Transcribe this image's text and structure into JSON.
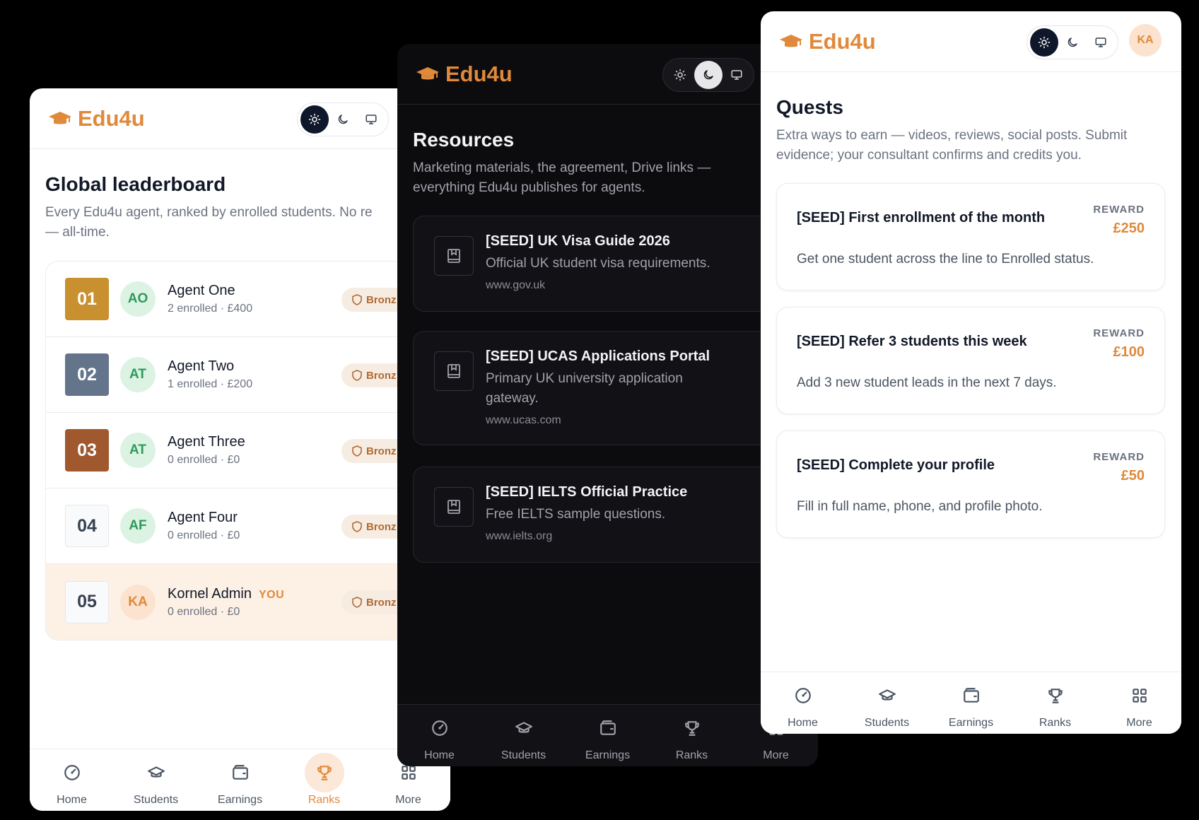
{
  "brand": "Edu4u",
  "colors": {
    "accent": "#e0893a",
    "gold": "#c8902f",
    "silver": "#64748b",
    "bronze": "#a0582e"
  },
  "nav": [
    "Home",
    "Students",
    "Earnings",
    "Ranks",
    "More"
  ],
  "leaderboard": {
    "title": "Global leaderboard",
    "subtitle": "Every Edu4u agent, ranked by enrolled students. No re",
    "subtitle2": "— all-time.",
    "rows": [
      {
        "rank": "01",
        "initials": "AO",
        "name": "Agent One",
        "meta": "2 enrolled · £400",
        "tier": "Bronz"
      },
      {
        "rank": "02",
        "initials": "AT",
        "name": "Agent Two",
        "meta": "1 enrolled · £200",
        "tier": "Bronz"
      },
      {
        "rank": "03",
        "initials": "AT",
        "name": "Agent Three",
        "meta": "0 enrolled · £0",
        "tier": "Bronz"
      },
      {
        "rank": "04",
        "initials": "AF",
        "name": "Agent Four",
        "meta": "0 enrolled · £0",
        "tier": "Bronz"
      },
      {
        "rank": "05",
        "initials": "KA",
        "name": "Kornel Admin",
        "you": "YOU",
        "meta": "0 enrolled · £0",
        "tier": "Bronz"
      }
    ]
  },
  "resources": {
    "title": "Resources",
    "subtitle": "Marketing materials, the agreement, Drive links —",
    "subtitle2": "everything Edu4u publishes for agents.",
    "items": [
      {
        "title": "[SEED] UK Visa Guide 2026",
        "desc": "Official UK student visa requirements.",
        "url": "www.gov.uk"
      },
      {
        "title": "[SEED] UCAS Applications Portal",
        "desc": "Primary UK university application gateway.",
        "url": "www.ucas.com"
      },
      {
        "title": "[SEED] IELTS Official Practice",
        "desc": "Free IELTS sample questions.",
        "url": "www.ielts.org"
      }
    ]
  },
  "quests": {
    "title": "Quests",
    "subtitle": "Extra ways to earn — videos, reviews, social posts. Submit evidence; your consultant confirms and credits you.",
    "avatar": "KA",
    "reward_label": "REWARD",
    "items": [
      {
        "title": "[SEED] First enrollment of the month",
        "amount": "£250",
        "desc": "Get one student across the line to Enrolled status."
      },
      {
        "title": "[SEED] Refer 3 students this week",
        "amount": "£100",
        "desc": "Add 3 new student leads in the next 7 days."
      },
      {
        "title": "[SEED] Complete your profile",
        "amount": "£50",
        "desc": "Fill in full name, phone, and profile photo."
      }
    ]
  }
}
